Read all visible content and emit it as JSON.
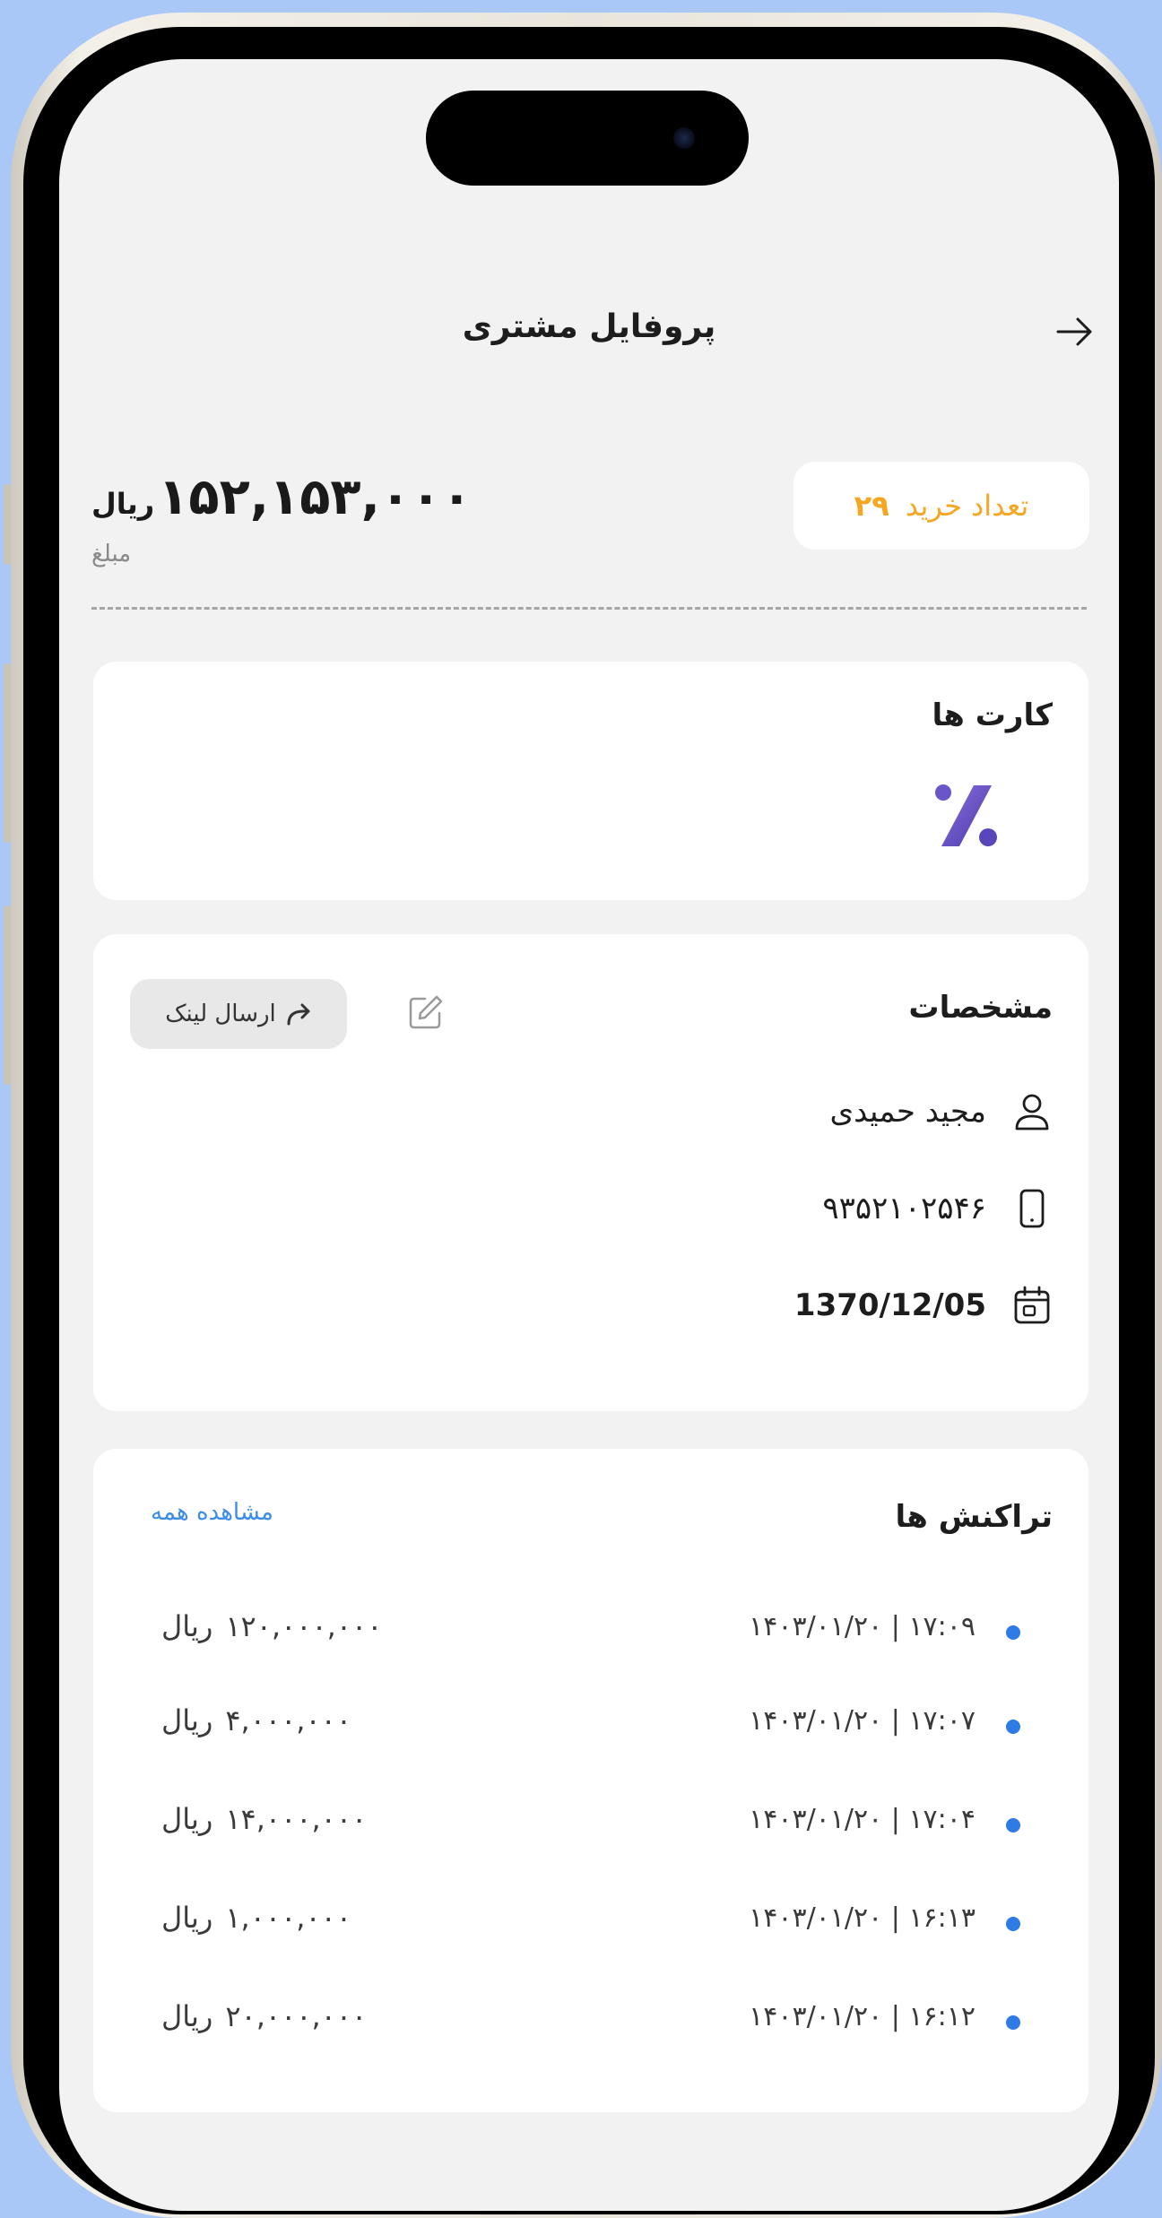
{
  "header": {
    "title": "پروفایل مشتری"
  },
  "summary": {
    "amount_value": "۱۵۲,۱۵۳,۰۰۰",
    "amount_currency": "ریال",
    "amount_label": "مبلغ",
    "purchase_count_label": "تعداد خرید",
    "purchase_count_value": "۲۹"
  },
  "cards": {
    "title": "کارت ها",
    "card_icon": "bank-card-logo-icon"
  },
  "details": {
    "title": "مشخصات",
    "send_link_label": "ارسال لینک",
    "name": "مجید حمیدی",
    "phone": "۹۳۵۲۱۰۲۵۴۶",
    "birth_date": "1370/12/05"
  },
  "transactions": {
    "title": "تراکنش ها",
    "see_all_label": "مشاهده همه",
    "currency": "ریال",
    "items": [
      {
        "date": "۱۴۰۳/۰۱/۲۰ | ۱۷:۰۹",
        "amount": "۱۲۰,۰۰۰,۰۰۰"
      },
      {
        "date": "۱۴۰۳/۰۱/۲۰ | ۱۷:۰۷",
        "amount": "۴,۰۰۰,۰۰۰"
      },
      {
        "date": "۱۴۰۳/۰۱/۲۰ | ۱۷:۰۴",
        "amount": "۱۴,۰۰۰,۰۰۰"
      },
      {
        "date": "۱۴۰۳/۰۱/۲۰ | ۱۶:۱۳",
        "amount": "۱,۰۰۰,۰۰۰"
      },
      {
        "date": "۱۴۰۳/۰۱/۲۰ | ۱۶:۱۲",
        "amount": "۲۰,۰۰۰,۰۰۰"
      }
    ]
  },
  "colors": {
    "accent_orange": "#f5a623",
    "link_blue": "#3d8ce8",
    "dot_blue": "#2f7be6",
    "background": "#a9c7f7"
  }
}
